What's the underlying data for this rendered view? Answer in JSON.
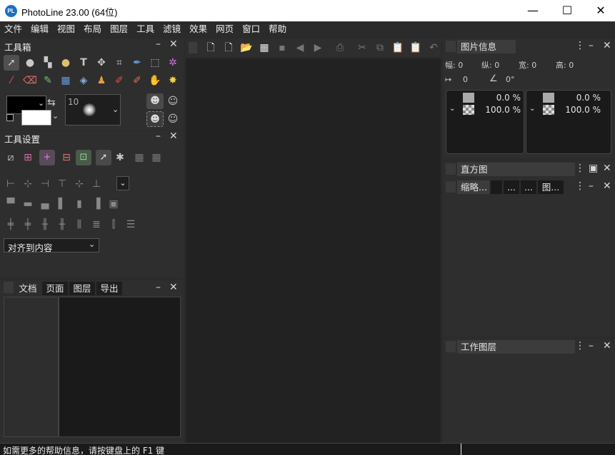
{
  "window": {
    "title": "PhotoLine 23.00 (64位)",
    "app_icon_text": "PL",
    "minimize": "—",
    "maximize": "☐",
    "close": "✕"
  },
  "menu": [
    "文件",
    "编辑",
    "视图",
    "布局",
    "图层",
    "工具",
    "滤镜",
    "效果",
    "网页",
    "窗口",
    "帮助"
  ],
  "toolbox": {
    "title": "工具箱",
    "brush_size": "10"
  },
  "tool_settings": {
    "title": "工具设置",
    "align_select": "对齐到内容"
  },
  "bottom_tabs": [
    "文档",
    "页面",
    "图层",
    "导出"
  ],
  "image_info": {
    "title": "图片信息",
    "fields": {
      "w": "幅: 0",
      "h": "纵: 0",
      "width": "宽: 0",
      "height": "高: 0",
      "dist": "0",
      "angle": "0°"
    },
    "swatches": [
      {
        "top_pct": "0.0 %",
        "bottom_pct": "100.0 %"
      },
      {
        "top_pct": "0.0 %",
        "bottom_pct": "100.0 %"
      }
    ]
  },
  "histogram": {
    "title": "直方图",
    "tabs": [
      "缩略...",
      "...",
      "...",
      "图..."
    ]
  },
  "work_layers": {
    "title": "工作图层"
  },
  "status": {
    "text": "如需更多的帮助信息，请按键盘上的 F1 键"
  }
}
